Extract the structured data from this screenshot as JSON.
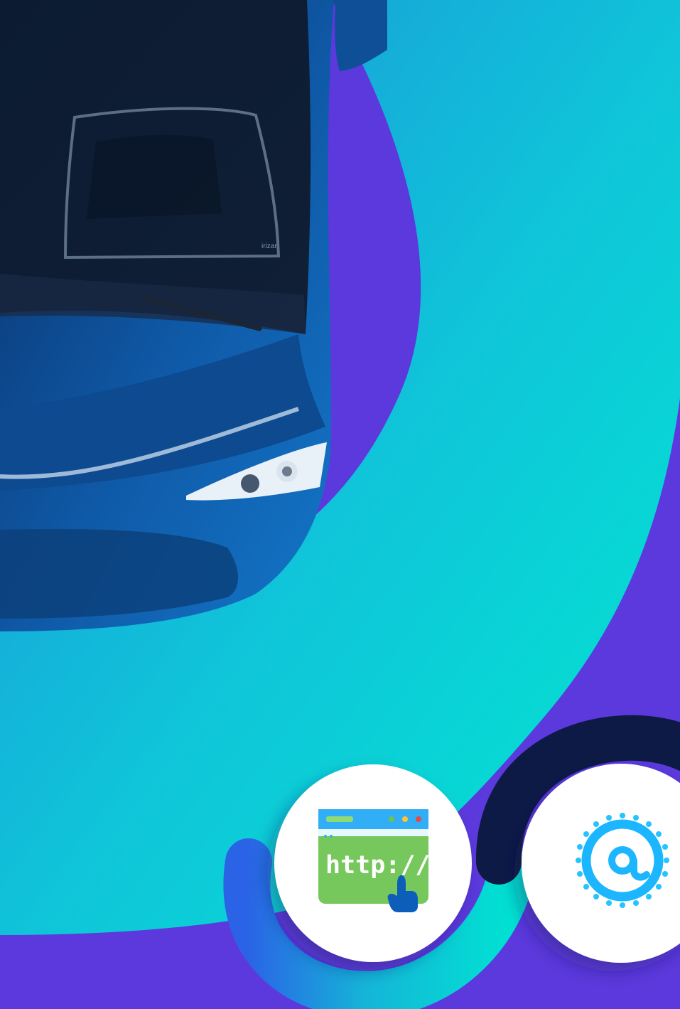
{
  "colors": {
    "background": "#5b39dc",
    "gradient_start": "#1b8fd6",
    "gradient_end": "#00e7d0",
    "navy_arc": "#0d1a45",
    "bus_blue": "#0f4e96",
    "icon_green": "#76c85b",
    "icon_blue": "#1fb6ff",
    "accent_blue": "#0d5dbb"
  },
  "brand": {
    "windshield_text": "irizar"
  },
  "icons": {
    "web_icon": {
      "name": "web-url-icon",
      "text": "http://"
    },
    "email_icon": {
      "name": "at-sign-icon"
    }
  }
}
